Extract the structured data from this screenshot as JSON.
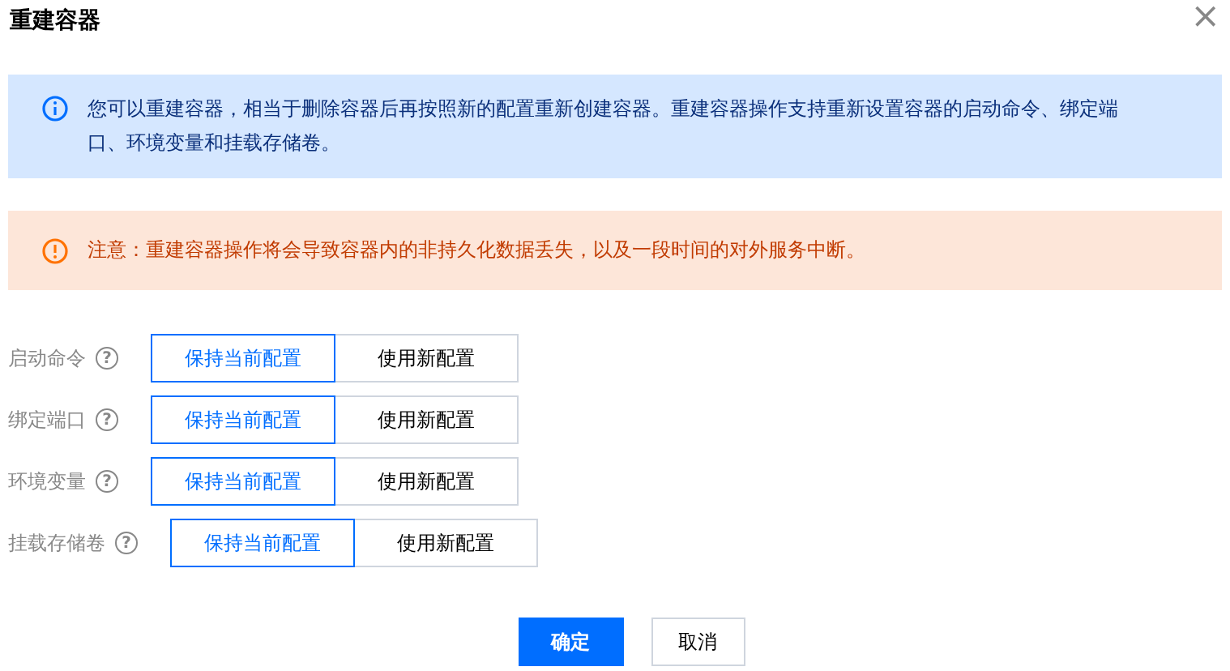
{
  "dialog": {
    "title": "重建容器",
    "close": "×"
  },
  "info_alert": {
    "text": "您可以重建容器，相当于删除容器后再按照新的配置重新创建容器。重建容器操作支持重新设置容器的启动命令、绑定端口、环境变量和挂载存储卷。"
  },
  "warning_alert": {
    "text": "注意：重建容器操作将会导致容器内的非持久化数据丢失，以及一段时间的对外服务中断。"
  },
  "settings": [
    {
      "label": "启动命令",
      "help": "?",
      "options": [
        {
          "label": "保持当前配置",
          "selected": true
        },
        {
          "label": "使用新配置",
          "selected": false
        }
      ]
    },
    {
      "label": "绑定端口",
      "help": "?",
      "options": [
        {
          "label": "保持当前配置",
          "selected": true
        },
        {
          "label": "使用新配置",
          "selected": false
        }
      ]
    },
    {
      "label": "环境变量",
      "help": "?",
      "options": [
        {
          "label": "保持当前配置",
          "selected": true
        },
        {
          "label": "使用新配置",
          "selected": false
        }
      ]
    },
    {
      "label": "挂载存储卷",
      "help": "?",
      "options": [
        {
          "label": "保持当前配置",
          "selected": true
        },
        {
          "label": "使用新配置",
          "selected": false
        }
      ]
    }
  ],
  "buttons": [
    {
      "label": "确定",
      "kind": "primary"
    },
    {
      "label": "取消",
      "kind": "secondary"
    }
  ]
}
